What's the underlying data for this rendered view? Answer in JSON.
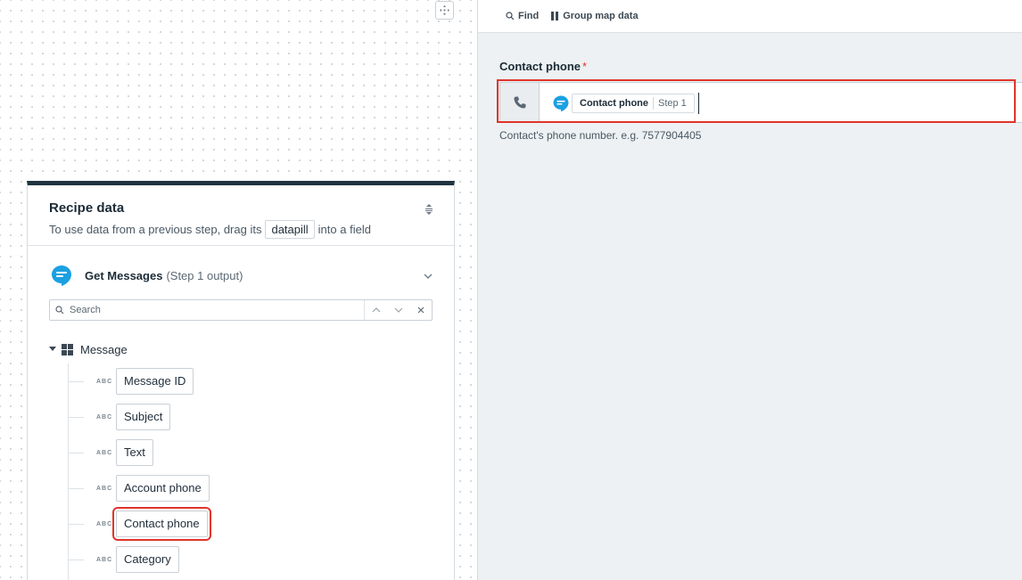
{
  "recipe_panel": {
    "title": "Recipe data",
    "subtitle_before": "To use data from a previous step, drag its",
    "subtitle_pill": "datapill",
    "subtitle_after": "into a field",
    "step": {
      "name": "Get Messages",
      "meta": "(Step 1 output)"
    },
    "search": {
      "placeholder": "Search"
    },
    "tree": {
      "root_label": "Message",
      "fields": [
        {
          "type": "ABC",
          "label": "Message ID"
        },
        {
          "type": "ABC",
          "label": "Subject"
        },
        {
          "type": "ABC",
          "label": "Text"
        },
        {
          "type": "ABC",
          "label": "Account phone"
        },
        {
          "type": "ABC",
          "label": "Contact phone",
          "selected": true
        },
        {
          "type": "ABC",
          "label": "Category"
        }
      ]
    }
  },
  "toolbar": {
    "find_label": "Find",
    "group_map_label": "Group map data"
  },
  "mapping_field": {
    "label": "Contact phone",
    "required_mark": "*",
    "pill_name": "Contact phone",
    "pill_step": "Step 1",
    "hint": "Contact's phone number. e.g. 7577904405"
  },
  "colors": {
    "accent_red": "#e0352b",
    "panel_header": "#1f3440",
    "app_blue": "#1ba0e2"
  }
}
